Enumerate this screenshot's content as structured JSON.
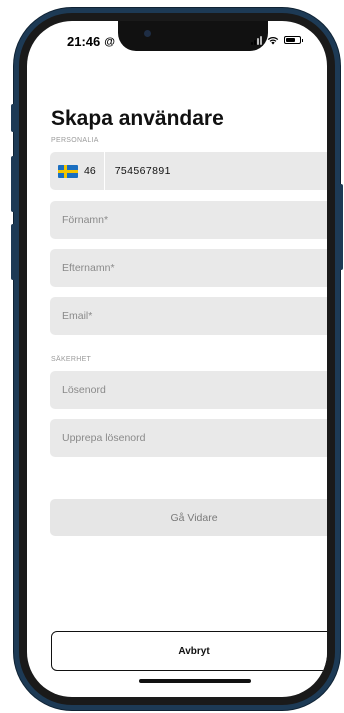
{
  "status_bar": {
    "time": "21:46",
    "at_icon": "@"
  },
  "page": {
    "title": "Skapa användare"
  },
  "personalia": {
    "section_label": "PERSONALIA",
    "phone": {
      "flag_icon": "sweden-flag-icon",
      "country_code": "46",
      "number": "754567891"
    },
    "first_name_placeholder": "Förnamn*",
    "last_name_placeholder": "Efternamn*",
    "email_placeholder": "Email*"
  },
  "security": {
    "section_label": "SÄKERHET",
    "password_placeholder": "Lösenord",
    "repeat_password_placeholder": "Upprepa lösenord"
  },
  "actions": {
    "continue_label": "Gå Vidare",
    "cancel_label": "Avbryt"
  },
  "colors": {
    "device_frame": "#1d3a55",
    "field_background": "#e9e9e9",
    "text_primary": "#111111",
    "text_placeholder": "#8a8a8a",
    "flag_blue": "#1b6fc0",
    "flag_yellow": "#f4c500"
  }
}
